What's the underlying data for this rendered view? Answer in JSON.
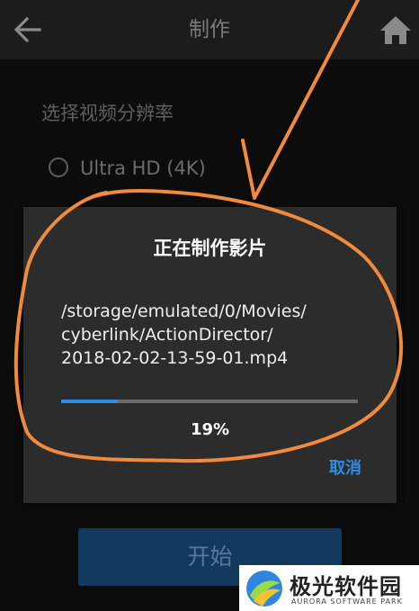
{
  "header": {
    "title": "制作",
    "back_icon": "arrow-left-icon",
    "home_icon": "home-icon"
  },
  "resolution": {
    "label": "选择视频分辨率",
    "options": [
      {
        "label": "Ultra HD (4K)",
        "selected": false
      }
    ]
  },
  "start_button": {
    "label": "开始"
  },
  "dialog": {
    "title": "正在制作影片",
    "path_lines": [
      "/storage/emulated/0/Movies/",
      "cyberlink/ActionDirector/",
      "2018-02-02-13-59-01.mp4"
    ],
    "progress": 0.19,
    "percent_text": "19%",
    "cancel_label": "取消"
  },
  "watermark": {
    "name": "极光软件园",
    "sub": "AURORA SOFTWARE PARK"
  },
  "colors": {
    "accent": "#2e8de6",
    "annotation": "#f08a3c",
    "dialog_bg": "#2c2c2c"
  }
}
